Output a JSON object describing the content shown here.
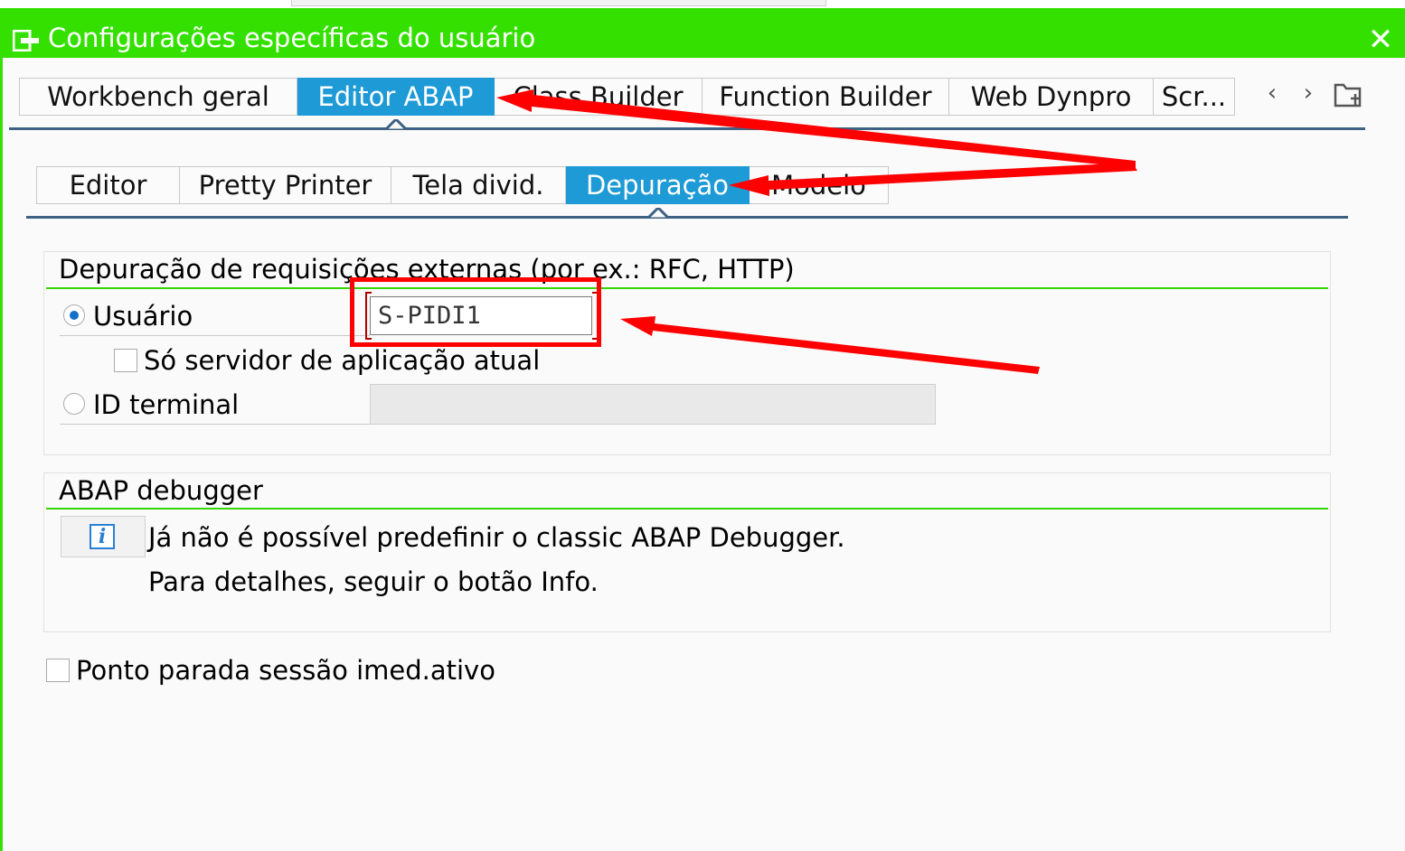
{
  "window": {
    "title": "Configurações específicas do usuário",
    "titlebar_color": "#34e000"
  },
  "main_tabs": [
    {
      "label": "Workbench geral",
      "active": false
    },
    {
      "label": "Editor ABAP",
      "active": true
    },
    {
      "label": "Class Builder",
      "active": false
    },
    {
      "label": "Function Builder",
      "active": false
    },
    {
      "label": "Web Dynpro",
      "active": false
    },
    {
      "label": "Scr...",
      "active": false
    }
  ],
  "sub_tabs": [
    {
      "label": "Editor",
      "active": false
    },
    {
      "label": "Pretty Printer",
      "active": false
    },
    {
      "label": "Tela divid.",
      "active": false
    },
    {
      "label": "Depuração",
      "active": true
    },
    {
      "label": "Modelo",
      "active": false
    }
  ],
  "external_debugging": {
    "title": "Depuração de requisições externas (por ex.: RFC, HTTP)",
    "user_label": "Usuário",
    "user_selected": true,
    "user_value": "S-PIDI1",
    "current_server_label": "Só servidor de aplicação atual",
    "current_server_checked": false,
    "terminal_label": "ID terminal",
    "terminal_selected": false,
    "terminal_value": ""
  },
  "abap_debugger": {
    "title": "ABAP debugger",
    "line1": "Já não é possível predefinir o classic ABAP Debugger.",
    "line2": "Para detalhes, seguir o botão Info.",
    "info_icon": "i"
  },
  "session_breakpoint": {
    "label": "Ponto parada sessão imed.ativo",
    "checked": false
  },
  "colors": {
    "active_tab": "#1e9ad6",
    "group_line": "#36d600",
    "annotation": "#ff0000"
  }
}
